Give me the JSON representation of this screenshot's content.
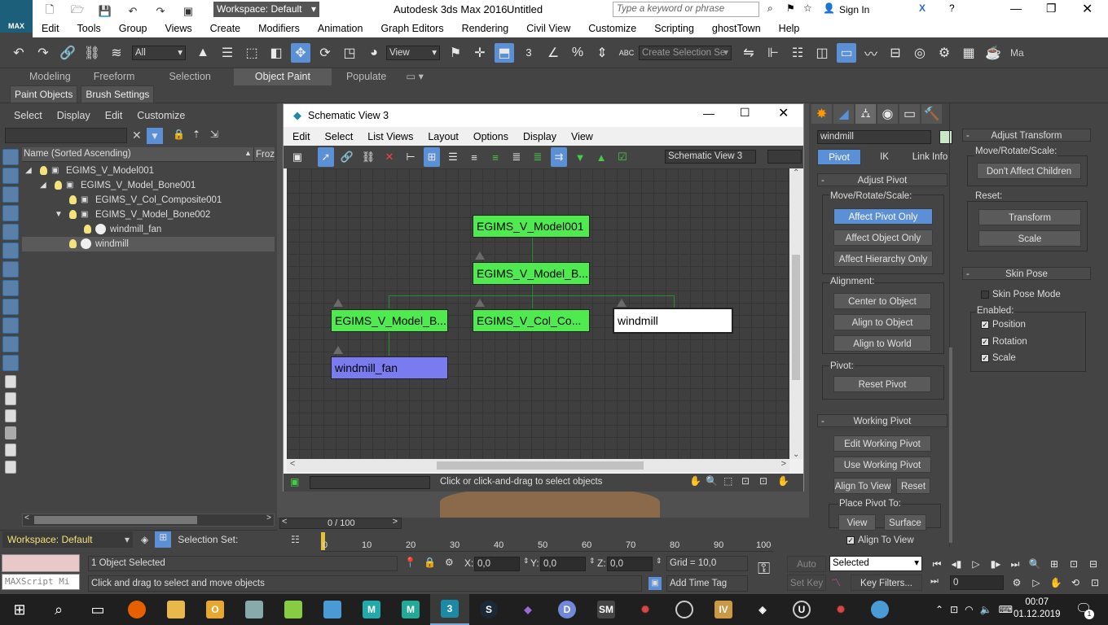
{
  "app": {
    "workspace_label": "Workspace: Default",
    "title": "Autodesk 3ds Max 2016",
    "doc_title": "Untitled",
    "search_placeholder": "Type a keyword or phrase",
    "sign_in": "Sign In",
    "max_logo": "MAX"
  },
  "menu": [
    "Edit",
    "Tools",
    "Group",
    "Views",
    "Create",
    "Modifiers",
    "Animation",
    "Graph Editors",
    "Rendering",
    "Civil View",
    "Customize",
    "Scripting",
    "ghostTown",
    "Help"
  ],
  "toolbar": {
    "filter_value": "All",
    "refcoord_value": "View",
    "selection_set_placeholder": "Create Selection Se",
    "snap_label": "3",
    "trailing_label": "Ma"
  },
  "ribbon": {
    "tabs": [
      "Modeling",
      "Freeform",
      "Selection",
      "Object Paint",
      "Populate"
    ],
    "selected_tab": 3,
    "buttons": [
      "Paint Objects",
      "Brush Settings"
    ]
  },
  "scene_explorer": {
    "menu": [
      "Select",
      "Display",
      "Edit",
      "Customize"
    ],
    "col_name": "Name (Sorted Ascending)",
    "col_frozen": "Frozi",
    "rows": [
      {
        "name": "EGIMS_V_Model001",
        "indent": 0,
        "expanded": true
      },
      {
        "name": "EGIMS_V_Model_Bone001",
        "indent": 1,
        "expanded": true
      },
      {
        "name": "EGIMS_V_Col_Composite001",
        "indent": 2,
        "expanded": false
      },
      {
        "name": "EGIMS_V_Model_Bone002",
        "indent": 2,
        "expanded": true
      },
      {
        "name": "windmill_fan",
        "indent": 3,
        "expanded": false
      },
      {
        "name": "windmill",
        "indent": 2,
        "expanded": false,
        "selected": true
      }
    ],
    "workspace": "Workspace: Default",
    "selection_set": "Selection Set:"
  },
  "schematic": {
    "title": "Schematic View 3",
    "menu": [
      "Edit",
      "Select",
      "List Views",
      "Layout",
      "Options",
      "Display",
      "View"
    ],
    "view_name": "Schematic View 3",
    "status": "Click or click-and-drag to select objects",
    "nodes": {
      "model": "EGIMS_V_Model001",
      "bone1": "EGIMS_V_Model_B...",
      "bone2": "EGIMS_V_Model_B...",
      "col": "EGIMS_V_Col_Co...",
      "windmill": "windmill",
      "fan": "windmill_fan"
    }
  },
  "command_panel": {
    "object_name": "windmill",
    "subtabs": [
      "Pivot",
      "IK",
      "Link Info"
    ],
    "adjust_pivot": {
      "title": "Adjust Pivot",
      "move_label": "Move/Rotate/Scale:",
      "buttons": [
        "Affect Pivot Only",
        "Affect Object Only",
        "Affect Hierarchy Only"
      ],
      "alignment_label": "Alignment:",
      "align_buttons": [
        "Center to Object",
        "Align to Object",
        "Align to World"
      ],
      "pivot_label": "Pivot:",
      "reset_pivot": "Reset Pivot"
    },
    "working_pivot": {
      "title": "Working Pivot",
      "edit": "Edit Working Pivot",
      "use": "Use Working Pivot",
      "align_to_view": "Align To View",
      "reset": "Reset",
      "place_label": "Place Pivot To:",
      "view": "View",
      "surface": "Surface",
      "align_to_view_cb": "Align To View"
    },
    "adjust_transform": {
      "title": "Adjust Transform",
      "move_label": "Move/Rotate/Scale:",
      "dont_affect": "Don't Affect Children",
      "reset_label": "Reset:",
      "transform": "Transform",
      "scale": "Scale"
    },
    "skin_pose": {
      "title": "Skin Pose",
      "mode": "Skin Pose Mode",
      "enabled_label": "Enabled:",
      "position": "Position",
      "rotation": "Rotation",
      "scale": "Scale"
    }
  },
  "timeline": {
    "frame": "0 / 100",
    "ticks": [
      "0",
      "10",
      "20",
      "30",
      "40",
      "50",
      "60",
      "70",
      "80",
      "90",
      "100"
    ]
  },
  "status": {
    "maxscript_placeholder": "MAXScript Mi",
    "selected": "1 Object Selected",
    "prompt": "Click and drag to select and move objects",
    "x_label": "X:",
    "x": "0,0",
    "y_label": "Y:",
    "y": "0,0",
    "z_label": "Z:",
    "z": "0,0",
    "grid": "Grid = 10,0",
    "add_time_tag": "Add Time Tag",
    "auto_key": "Auto Key",
    "set_key": "Set Key",
    "key_mode": "Selected",
    "key_filters": "Key Filters...",
    "frame_field": "0"
  },
  "taskbar": {
    "time": "00:07",
    "date": "01.12.2019",
    "notification_count": "1"
  }
}
